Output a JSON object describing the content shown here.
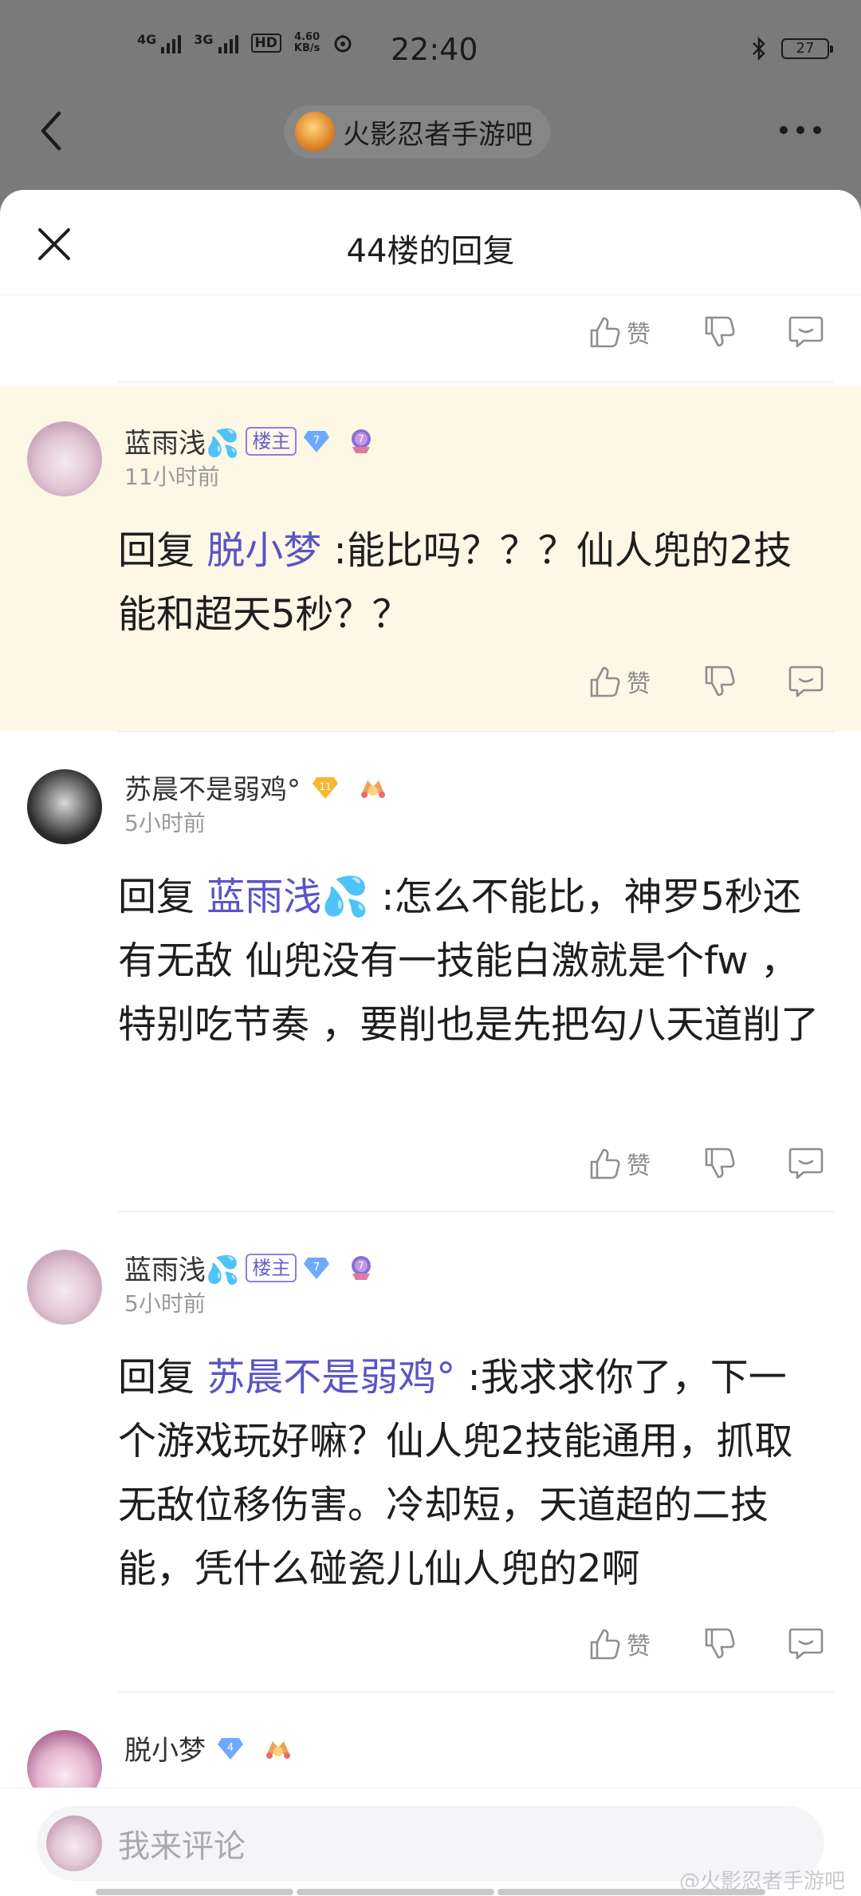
{
  "status_bar": {
    "net1": "4G",
    "net2": "3G",
    "hd": "HD",
    "hd_sub": "1",
    "speed_value": "4.60",
    "speed_unit": "KB/s",
    "time": "22:40",
    "battery": "27"
  },
  "nav": {
    "forum_name": "火影忍者手游吧"
  },
  "sheet": {
    "title": "44楼的回复"
  },
  "actions": {
    "like_label": "赞"
  },
  "comments": [
    {
      "username": "蓝雨浅💦",
      "owner_badge": "楼主",
      "level": "7",
      "medal_level": "7",
      "time": "11小时前",
      "reply_prefix": "回复 ",
      "mention": "脱小梦",
      "text": " :能比吗？？？仙人兜的2技能和超天5秒？？"
    },
    {
      "username": "苏晨不是弱鸡°",
      "level": "11",
      "time": "5小时前",
      "reply_prefix": "回复 ",
      "mention": "蓝雨浅💦",
      "text": " :怎么不能比，神罗5秒还有无敌 仙兜没有一技能白激就是个fw ，特别吃节奏 ，要削也是先把勾八天道削了"
    },
    {
      "username": "蓝雨浅💦",
      "owner_badge": "楼主",
      "level": "7",
      "medal_level": "7",
      "time": "5小时前",
      "reply_prefix": "回复 ",
      "mention": "苏晨不是弱鸡°",
      "text": " :我求求你了，下一个游戏玩好嘛？仙人兜2技能通用，抓取无敌位移伤害。冷却短，天道超的二技能，凭什么碰瓷儿仙人兜的2啊"
    },
    {
      "username": "脱小梦",
      "level": "4"
    }
  ],
  "input": {
    "placeholder": "我来评论"
  },
  "watermark": "@火影忍者手游吧",
  "colors": {
    "mention": "#5a54c6",
    "highlight_bg": "#fdf8e6",
    "owner_badge": "#8a80e0",
    "gem_blue": "#6fa8ff",
    "gem_gold": "#f7b733"
  }
}
